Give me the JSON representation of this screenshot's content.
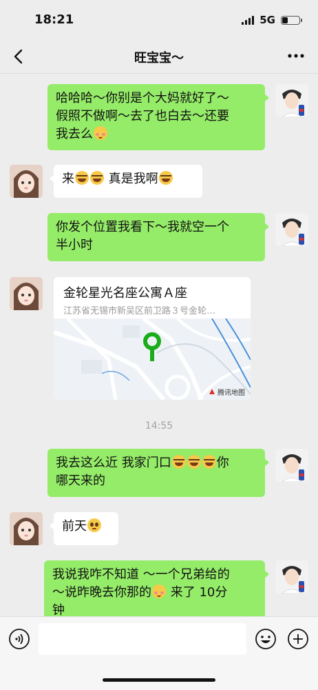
{
  "status_bar": {
    "time": "18:21",
    "network": "5G"
  },
  "header": {
    "title": "旺宝宝～"
  },
  "messages": [
    {
      "side": "me",
      "lines": [
        "哈哈哈～你别是个大妈就好了～",
        "假照不做啊～去了也白去～还要",
        "我去么"
      ]
    },
    {
      "side": "them",
      "parts": [
        "来",
        "真是我啊"
      ]
    },
    {
      "side": "me",
      "lines": [
        "你发个位置我看下～我就空一个",
        "半小时"
      ]
    },
    {
      "side": "them",
      "type": "location",
      "title": "金轮星光名座公寓Ａ座",
      "address": "江苏省无锡市新吴区前卫路３号金轮…",
      "map_attribution": "腾讯地图"
    },
    {
      "side": "me",
      "lines": [
        "我去这么近 我家门口",
        "你",
        "哪天来的"
      ]
    },
    {
      "side": "them",
      "parts": [
        "前天"
      ]
    },
    {
      "side": "me",
      "lines": [
        "我说我咋不知道 ～一个兄弟给的",
        "～说昨晚去你那的",
        "来了 10分",
        "钟"
      ]
    }
  ],
  "timestamp": "14:55",
  "icons": {
    "back": "chevron-left-icon",
    "more": "more-dots-icon",
    "voice": "voice-icon",
    "emoji": "emoji-icon",
    "plus": "plus-icon",
    "signal": "signal-icon",
    "battery": "battery-icon"
  },
  "colors": {
    "me_bubble": "#95ec69",
    "them_bubble": "#ffffff",
    "background": "#ededed",
    "map_pin": "#1aad19"
  }
}
